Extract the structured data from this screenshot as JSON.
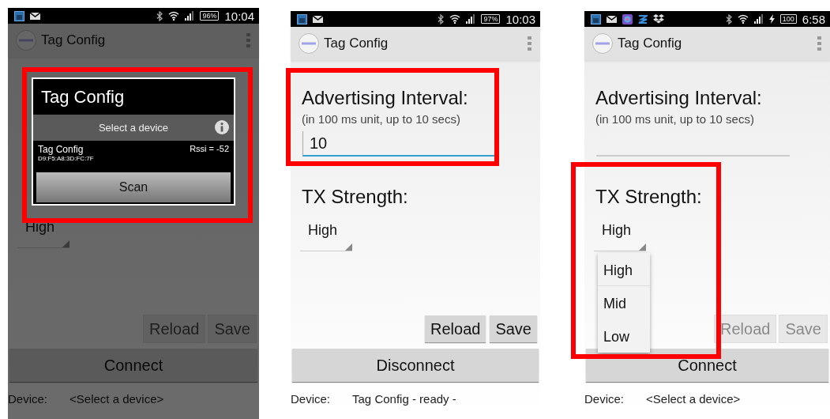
{
  "panels": [
    {
      "status_bar": {
        "notifications": [
          {
            "kind": "calendar"
          },
          {
            "kind": "mail"
          }
        ],
        "battery": "96%",
        "charging": false,
        "time": "10:04"
      },
      "app_bar": {
        "title": "Tag Config"
      },
      "dimmed": true,
      "form": {
        "tx_value": "High"
      },
      "buttons": [
        {
          "label": "Reload",
          "disabled": true
        },
        {
          "label": "Save",
          "disabled": true
        }
      ],
      "main_button": {
        "label": "Connect"
      },
      "device": {
        "label": "Device:",
        "value": "<Select a device>"
      },
      "dialog": {
        "title": "Tag Config",
        "subtitle": "Select a device",
        "devices": [
          {
            "name": "Tag Config",
            "address": "D9:F5:A8:3D:FC:7F",
            "rssi": "Rssi = -52"
          }
        ],
        "button": "Scan"
      },
      "highlight": {
        "kind": "dialog"
      }
    },
    {
      "status_bar": {
        "notifications": [
          {
            "kind": "calendar"
          },
          {
            "kind": "mail"
          }
        ],
        "battery": "97%",
        "charging": false,
        "time": "10:03"
      },
      "app_bar": {
        "title": "Tag Config"
      },
      "dimmed": false,
      "form": {
        "interval_label": "Advertising Interval:",
        "interval_hint": "(in 100 ms unit, up to 10 secs)",
        "interval_value": "10",
        "interval_focused": true,
        "tx_label": "TX Strength:",
        "tx_value": "High"
      },
      "buttons": [
        {
          "label": "Reload",
          "disabled": false
        },
        {
          "label": "Save",
          "disabled": false
        }
      ],
      "main_button": {
        "label": "Disconnect"
      },
      "device": {
        "label": "Device:",
        "value": "Tag Config - ready -"
      },
      "highlight": {
        "kind": "interval"
      }
    },
    {
      "status_bar": {
        "notifications": [
          {
            "kind": "calendar"
          },
          {
            "kind": "mail"
          },
          {
            "kind": "app"
          },
          {
            "kind": "stack"
          },
          {
            "kind": "boxes"
          }
        ],
        "battery": "100",
        "charging": true,
        "time": "6:58"
      },
      "app_bar": {
        "title": "Tag Config"
      },
      "dimmed": false,
      "form": {
        "interval_label": "Advertising Interval:",
        "interval_hint": "(in 100 ms unit, up to 10 secs)",
        "interval_focused": false,
        "tx_label": "TX Strength:",
        "tx_value": "High"
      },
      "buttons": [
        {
          "label": "Reload",
          "disabled": true
        },
        {
          "label": "Save",
          "disabled": true
        }
      ],
      "main_button": {
        "label": "Connect"
      },
      "device": {
        "label": "Device:",
        "value": "<Select a device>"
      },
      "dropdown": {
        "options": [
          {
            "label": "High",
            "selected": true
          },
          {
            "label": "Mid",
            "selected": false
          },
          {
            "label": "Low",
            "selected": false
          }
        ]
      },
      "highlight": {
        "kind": "tx"
      }
    }
  ]
}
